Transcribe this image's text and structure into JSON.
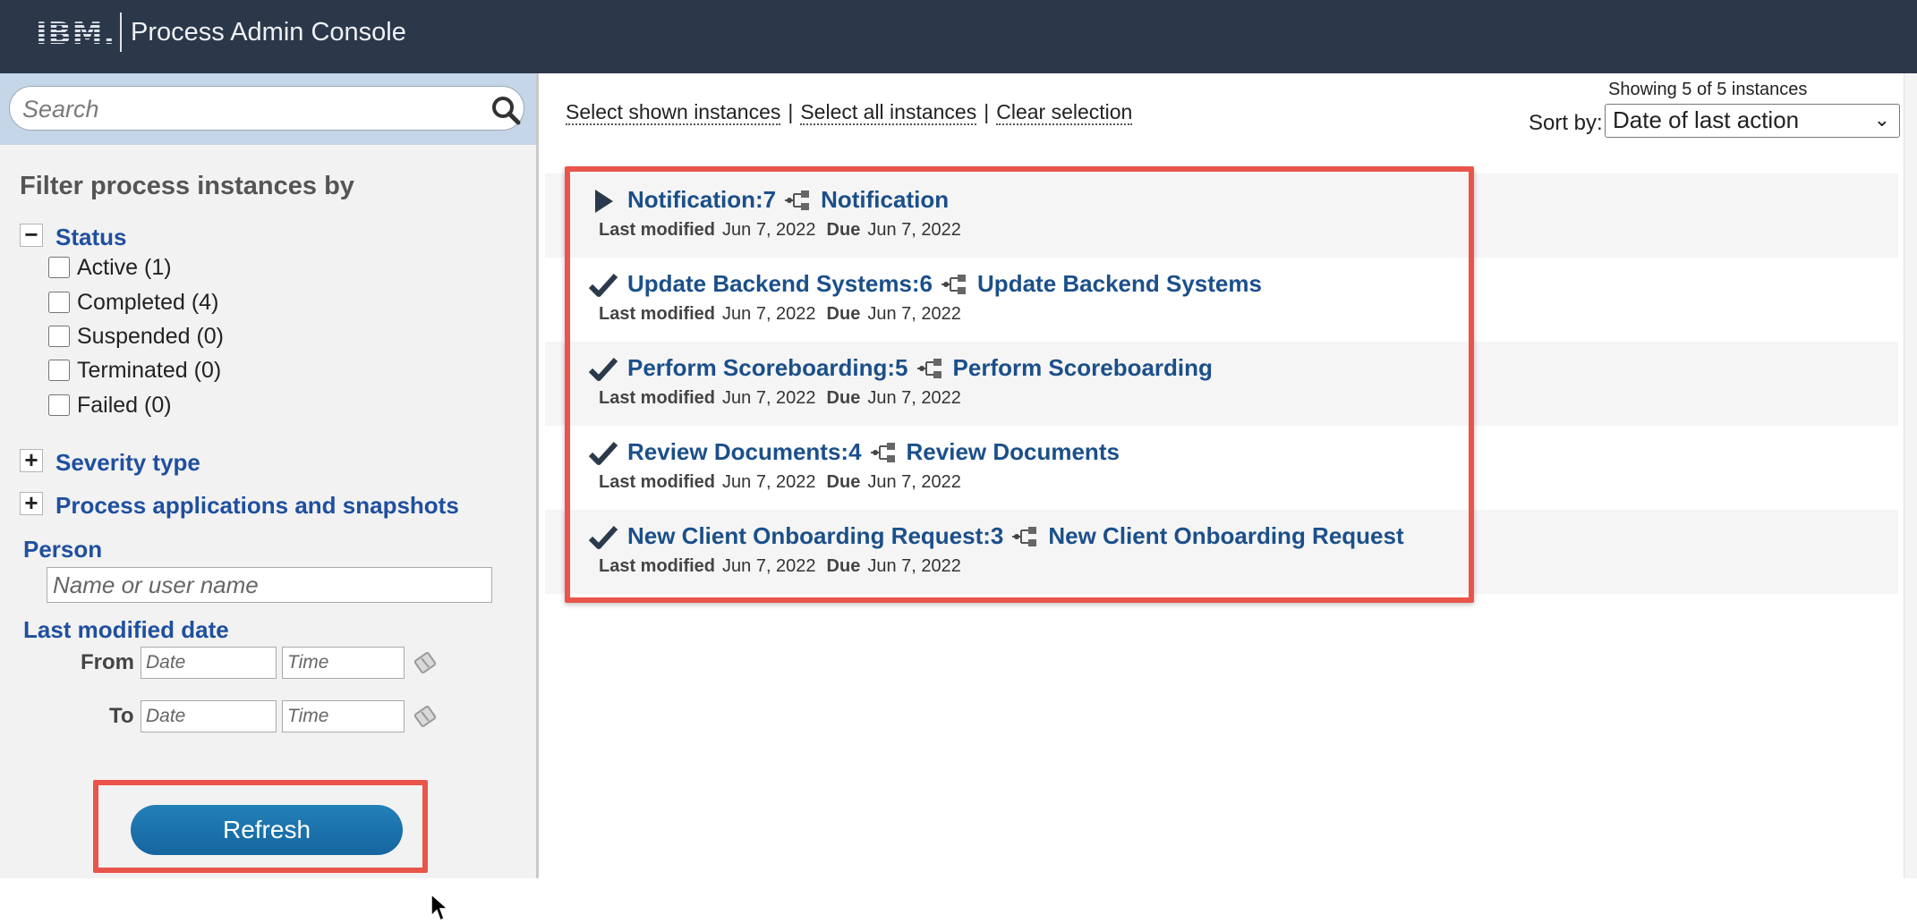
{
  "header": {
    "logo": "IBM.",
    "title": "Process Admin Console"
  },
  "sidebar": {
    "search_placeholder": "Search",
    "filter_title": "Filter process instances by",
    "status": {
      "label": "Status",
      "toggle": "−",
      "options": [
        {
          "label": "Active (1)"
        },
        {
          "label": "Completed (4)"
        },
        {
          "label": "Suspended (0)"
        },
        {
          "label": "Terminated (0)"
        },
        {
          "label": "Failed (0)"
        }
      ]
    },
    "severity": {
      "label": "Severity type",
      "toggle": "+"
    },
    "process_apps": {
      "label": "Process applications and snapshots",
      "toggle": "+"
    },
    "person": {
      "label": "Person",
      "placeholder": "Name or user name"
    },
    "last_modified": {
      "label": "Last modified date",
      "from_label": "From",
      "to_label": "To",
      "date_placeholder": "Date",
      "time_placeholder": "Time"
    },
    "refresh_label": "Refresh"
  },
  "main": {
    "select_shown": "Select shown instances",
    "select_all": "Select all instances",
    "clear_selection": "Clear selection",
    "separator": "|",
    "showing": "Showing 5 of 5 instances",
    "sort_label": "Sort by:",
    "sort_value": "Date of last action",
    "meta_labels": {
      "last_modified": "Last modified",
      "due": "Due"
    },
    "instances": [
      {
        "name": "Notification:7",
        "process": "Notification",
        "status_icon": "play-icon",
        "last_modified": "Jun 7, 2022",
        "due": "Jun 7, 2022"
      },
      {
        "name": "Update Backend Systems:6",
        "process": "Update Backend Systems",
        "status_icon": "checkmark-icon",
        "last_modified": "Jun 7, 2022",
        "due": "Jun 7, 2022"
      },
      {
        "name": "Perform Scoreboarding:5",
        "process": "Perform Scoreboarding",
        "status_icon": "checkmark-icon",
        "last_modified": "Jun 7, 2022",
        "due": "Jun 7, 2022"
      },
      {
        "name": "Review Documents:4",
        "process": "Review Documents",
        "status_icon": "checkmark-icon",
        "last_modified": "Jun 7, 2022",
        "due": "Jun 7, 2022"
      },
      {
        "name": "New Client Onboarding Request:3",
        "process": "New Client Onboarding Request",
        "status_icon": "checkmark-icon",
        "last_modified": "Jun 7, 2022",
        "due": "Jun 7, 2022"
      }
    ]
  },
  "colors": {
    "header_bg": "#2b384a",
    "link_blue": "#1b4f8a",
    "section_blue": "#1f4f9f",
    "highlight_red": "#e9554a",
    "button_blue": "#1a72ad"
  }
}
